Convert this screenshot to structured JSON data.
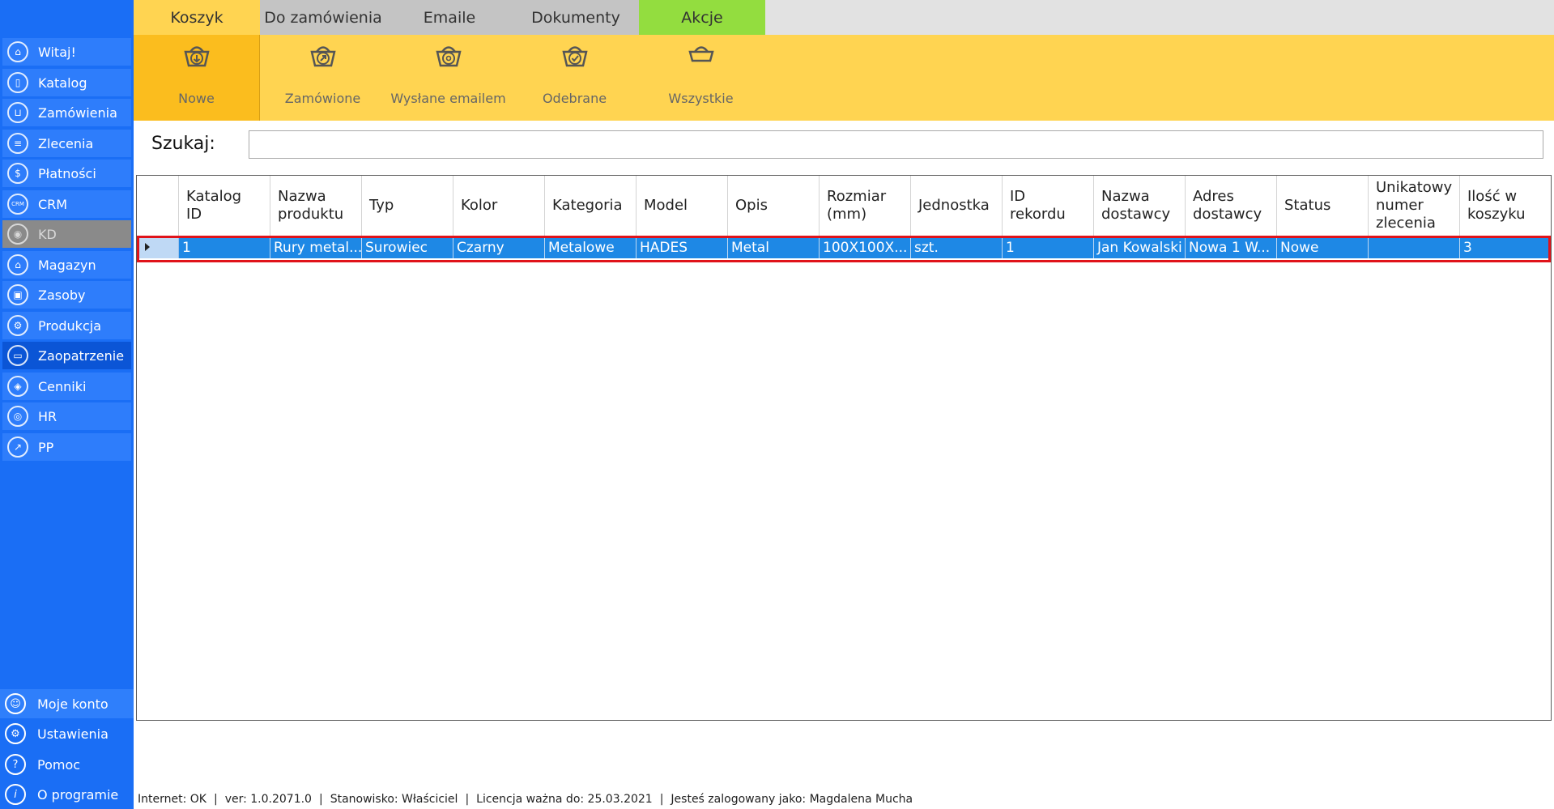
{
  "sidebar": {
    "items": [
      {
        "label": "Witaj!",
        "icon": "home-icon"
      },
      {
        "label": "Katalog",
        "icon": "book-icon"
      },
      {
        "label": "Zamówienia",
        "icon": "cart-icon"
      },
      {
        "label": "Zlecenia",
        "icon": "list-icon"
      },
      {
        "label": "Płatności",
        "icon": "dollar-icon"
      },
      {
        "label": "CRM",
        "icon": "crm-icon"
      },
      {
        "label": "KD",
        "icon": "user-lock-icon"
      },
      {
        "label": "Magazyn",
        "icon": "warehouse-icon"
      },
      {
        "label": "Zasoby",
        "icon": "box-icon"
      },
      {
        "label": "Produkcja",
        "icon": "factory-icon"
      },
      {
        "label": "Zaopatrzenie",
        "icon": "truck-icon"
      },
      {
        "label": "Cenniki",
        "icon": "tag-icon"
      },
      {
        "label": "HR",
        "icon": "people-icon"
      },
      {
        "label": "PP",
        "icon": "chart-icon"
      }
    ],
    "bottom": [
      {
        "label": "Moje konto",
        "icon": "account-icon"
      },
      {
        "label": "Ustawienia",
        "icon": "gear-icon"
      },
      {
        "label": "Pomoc",
        "icon": "help-icon"
      },
      {
        "label": "O programie",
        "icon": "info-icon"
      }
    ]
  },
  "tabs": [
    {
      "label": "Koszyk"
    },
    {
      "label": "Do zamówienia"
    },
    {
      "label": "Emaile"
    },
    {
      "label": "Dokumenty"
    },
    {
      "label": "Akcje"
    }
  ],
  "ribbon": [
    {
      "label": "Nowe",
      "icon": "basket-download-icon"
    },
    {
      "label": "Zamówione",
      "icon": "basket-arrow-icon"
    },
    {
      "label": "Wysłane emailem",
      "icon": "basket-email-icon"
    },
    {
      "label": "Odebrane",
      "icon": "basket-check-icon"
    },
    {
      "label": "Wszystkie",
      "icon": "basket-icon"
    }
  ],
  "search": {
    "label": "Szukaj:",
    "value": "",
    "placeholder": ""
  },
  "table": {
    "columns": [
      "Katalog\nID",
      "Nazwa\nproduktu",
      "Typ",
      "Kolor",
      "Kategoria",
      "Model",
      "Opis",
      "Rozmiar\n(mm)",
      "Jednostka",
      "ID\nrekordu",
      "Nazwa\ndostawcy",
      "Adres\ndostawcy",
      "Status",
      "Unikatowy\nnumer\nzlecenia",
      "Ilość w\nkoszyku"
    ],
    "rows": [
      [
        "1",
        "Rury metal...",
        "Surowiec",
        "Czarny",
        "Metalowe",
        "HADES",
        "Metal",
        "100X100X...",
        "szt.",
        "1",
        "Jan Kowalski",
        "Nowa 1 W...",
        "Nowe",
        "",
        "3"
      ]
    ]
  },
  "status": {
    "internet": "Internet: OK",
    "version": "ver: 1.0.2071.0",
    "station": "Stanowisko: Właściciel",
    "license": "Licencja ważna do: 25.03.2021",
    "user": "Jesteś zalogowany jako: Magdalena Mucha"
  },
  "colors": {
    "sidebar": "#1a6ef5",
    "sidebar_item": "#2e7dfb",
    "sidebar_active": "#0b55d6",
    "ribbon": "#ffd451",
    "ribbon_active": "#fbbd1e",
    "tab_active": "#ffd451",
    "tab_actions": "#93dd3f",
    "selected_row": "#1e88e5",
    "highlight_border": "#e0131a"
  }
}
